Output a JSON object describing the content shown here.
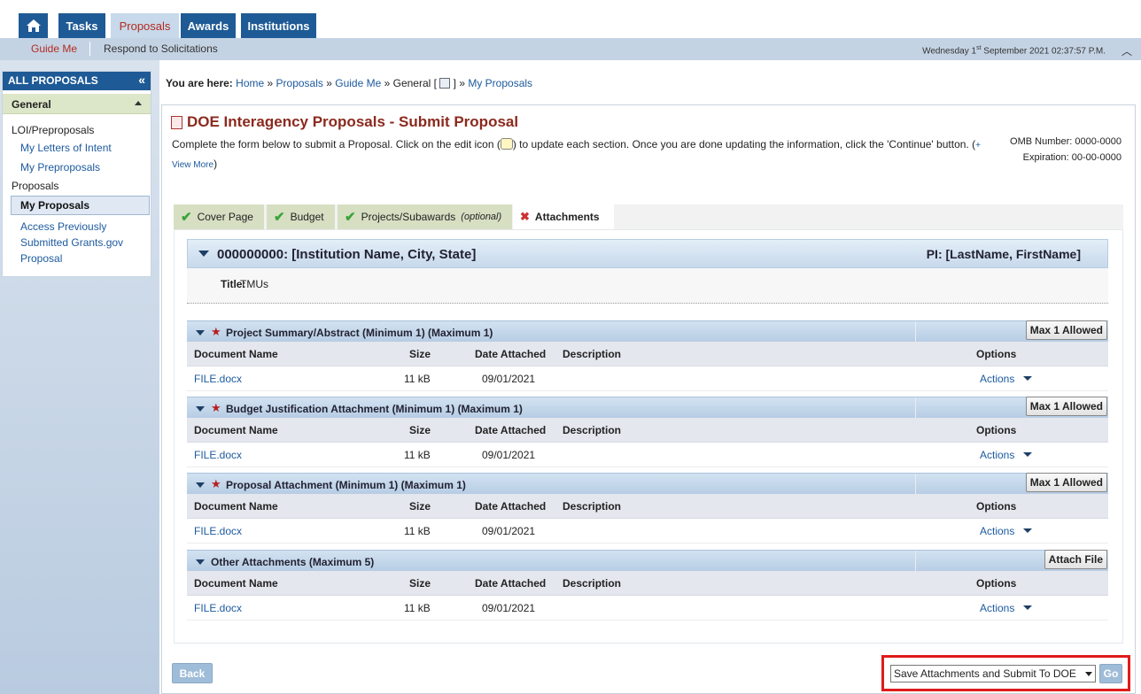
{
  "nav": {
    "home_icon": "home-icon",
    "tabs": [
      {
        "label": "Tasks"
      },
      {
        "label": "Proposals"
      },
      {
        "label": "Awards"
      },
      {
        "label": "Institutions"
      }
    ],
    "subnav": [
      {
        "label": "Guide Me"
      },
      {
        "label": "Respond to Solicitations"
      }
    ],
    "datetime_day": "Wednesday 1",
    "datetime_sup": "st",
    "datetime_rest": " September 2021 02:37:57 P.M."
  },
  "sidebar": {
    "header": "ALL PROPOSALS",
    "collapse_icon": "double-chevron-left-icon",
    "group": "General",
    "sections": [
      {
        "title": "LOI/Preproposals",
        "items": [
          "My Letters of Intent",
          "My Preproposals"
        ]
      },
      {
        "title": "Proposals",
        "items": [
          "My Proposals",
          "Access Previously Submitted Grants.gov Proposal"
        ]
      }
    ]
  },
  "breadcrumb": {
    "prefix": "You are here:",
    "items": [
      "Home",
      "Proposals",
      "Guide Me",
      "General [",
      "] »",
      "My Proposals"
    ]
  },
  "page": {
    "title": "DOE Interagency Proposals - Submit Proposal",
    "desc_part1": "Complete the form below to submit a Proposal. Click on the edit icon (",
    "desc_part2": ") to update each section. Once you are done updating the information, click the 'Continue' button. (",
    "view_more": "+ View More",
    "desc_end": ")",
    "omb_label": "OMB Number:",
    "omb_value": "0000-0000",
    "exp_label": "Expiration:",
    "exp_value": "00-00-0000"
  },
  "tabs": [
    {
      "label": "Cover Page",
      "status": "complete"
    },
    {
      "label": "Budget",
      "status": "complete"
    },
    {
      "label": "Projects/Subawards",
      "suffix": "(optional)",
      "status": "complete"
    },
    {
      "label": "Attachments",
      "status": "active"
    }
  ],
  "institution": {
    "name": "000000000: [Institution Name, City, State]",
    "pi": "PI: [LastName, FirstName]",
    "title_label": "Title:",
    "title_value": "TMUs"
  },
  "columns": {
    "doc": "Document Name",
    "size": "Size",
    "date": "Date Attached",
    "desc": "Description",
    "options": "Options"
  },
  "sections": [
    {
      "title": "Project Summary/Abstract (Minimum 1) (Maximum 1)",
      "required": true,
      "button": "Max 1 Allowed",
      "row": {
        "doc": "FILE.docx",
        "size": "11 kB",
        "date": "09/01/2021",
        "desc": "",
        "action": "Actions"
      }
    },
    {
      "title": "Budget Justification Attachment (Minimum 1) (Maximum 1)",
      "required": true,
      "button": "Max 1 Allowed",
      "row": {
        "doc": "FILE.docx",
        "size": "11 kB",
        "date": "09/01/2021",
        "desc": "",
        "action": "Actions"
      }
    },
    {
      "title": "Proposal Attachment (Minimum 1) (Maximum 1)",
      "required": true,
      "button": "Max 1 Allowed",
      "row": {
        "doc": "FILE.docx",
        "size": "11 kB",
        "date": "09/01/2021",
        "desc": "",
        "action": "Actions"
      }
    },
    {
      "title": "Other Attachments (Maximum 5)",
      "required": false,
      "button": "Attach File",
      "row": {
        "doc": "FILE.docx",
        "size": "11 kB",
        "date": "09/01/2021",
        "desc": "",
        "action": "Actions"
      }
    }
  ],
  "footer": {
    "back": "Back",
    "submit_option": "Save Attachments and Submit To DOE",
    "go": "Go"
  },
  "colors": {
    "nav_blue": "#1e5a95",
    "title_red": "#8b2a1e",
    "highlight_red": "#e01b1b",
    "tab_green": "#d7dfc3"
  }
}
